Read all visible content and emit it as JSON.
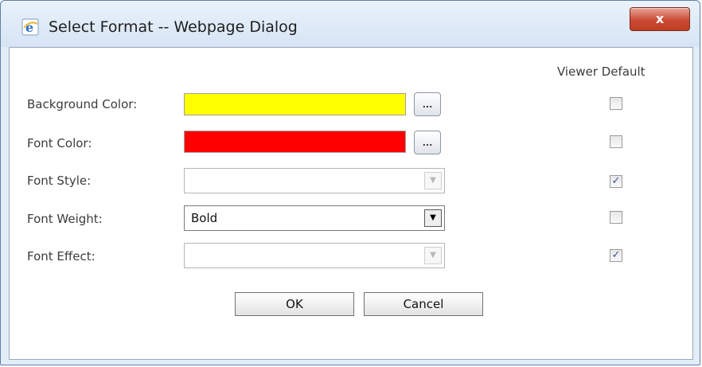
{
  "window": {
    "title": "Select Format -- Webpage Dialog",
    "close_label": "x"
  },
  "form": {
    "default_column_header": "Viewer Default",
    "rows": [
      {
        "label": "Background Color:",
        "color": "#ffff00",
        "picker_label": "...",
        "viewer_default": false
      },
      {
        "label": "Font Color:",
        "color": "#ff0000",
        "picker_label": "...",
        "viewer_default": false
      },
      {
        "label": "Font Style:",
        "value": "",
        "viewer_default": true
      },
      {
        "label": "Font Weight:",
        "value": "Bold",
        "viewer_default": false
      },
      {
        "label": "Font Effect:",
        "value": "",
        "viewer_default": true
      }
    ],
    "check_mark": "✓"
  },
  "buttons": {
    "ok_label": "OK",
    "cancel_label": "Cancel"
  }
}
